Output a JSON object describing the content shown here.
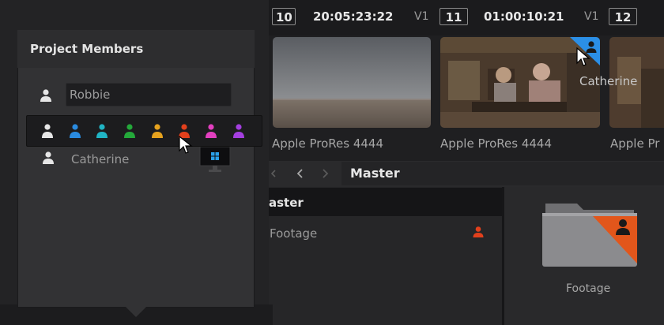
{
  "popup": {
    "title": "Project Members",
    "members": [
      {
        "name": "Robbie",
        "editing": true
      },
      {
        "name": "Catherine",
        "editing": false
      }
    ],
    "color_options": [
      {
        "name": "white",
        "color": "#e6e6e6"
      },
      {
        "name": "blue",
        "color": "#2a8be0"
      },
      {
        "name": "cyan",
        "color": "#20b4c4"
      },
      {
        "name": "green",
        "color": "#24a83a"
      },
      {
        "name": "yellow",
        "color": "#e6a21e"
      },
      {
        "name": "red",
        "color": "#e2401c"
      },
      {
        "name": "pink",
        "color": "#e23fbf"
      },
      {
        "name": "purple",
        "color": "#a43fe0"
      }
    ]
  },
  "timeline": {
    "clips": [
      {
        "number": "10",
        "timecode": "20:05:23:22",
        "track": "V1"
      },
      {
        "number": "11",
        "timecode": "01:00:10:21",
        "track": "V1"
      },
      {
        "number": "12"
      }
    ],
    "thumbnails": [
      {
        "label": "Apple ProRes 4444"
      },
      {
        "label": "Apple ProRes 4444",
        "locked_by": "Catherine"
      },
      {
        "label": "Apple Pr"
      }
    ]
  },
  "browser": {
    "path": "Master",
    "bin_header": "aster",
    "bins": [
      {
        "name": "Footage"
      }
    ],
    "grid_items": [
      {
        "name": "Footage"
      }
    ]
  },
  "colors": {
    "lock_blue": "#2b8fe6",
    "lock_orange": "#e2561b",
    "bin_red": "#e2401c"
  }
}
